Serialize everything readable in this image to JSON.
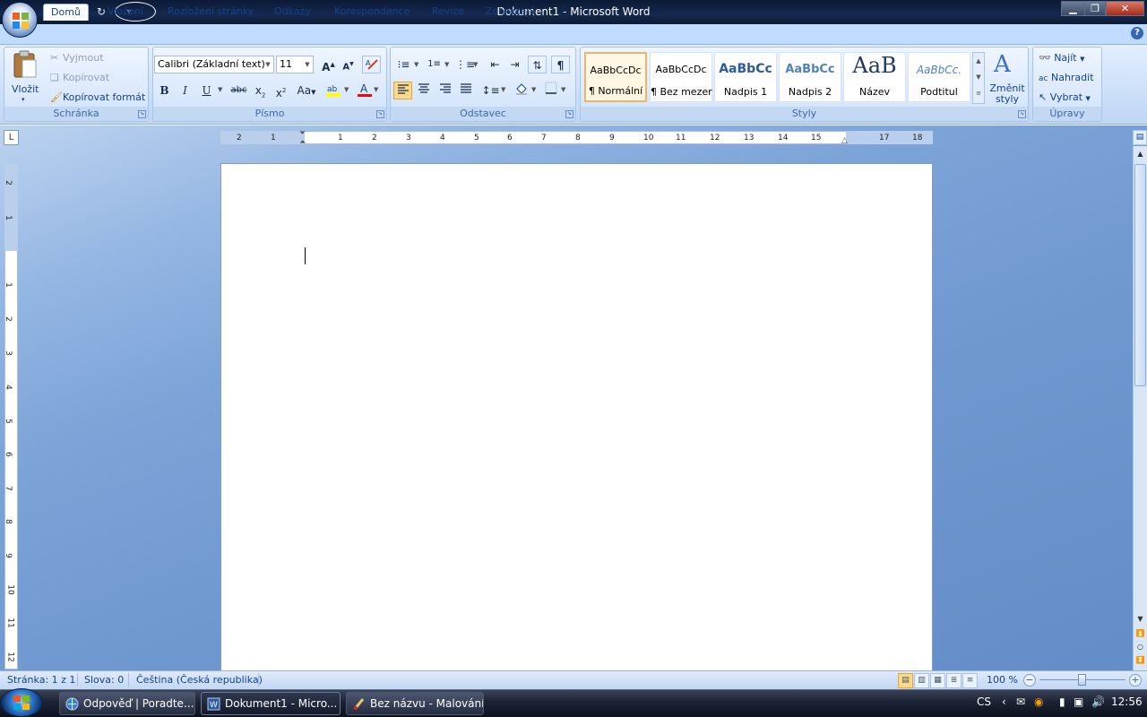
{
  "window": {
    "title": "Dokument1 - Microsoft Word"
  },
  "tabs": [
    "Domů",
    "Vložení",
    "Rozložení stránky",
    "Odkazy",
    "Korespondence",
    "Revize",
    "Zobrazení"
  ],
  "clipboard": {
    "paste": "Vložit",
    "cut": "Vyjmout",
    "copy": "Kopírovat",
    "format_painter": "Kopírovat formát",
    "label": "Schránka"
  },
  "font": {
    "family": "Calibri (Základní text)",
    "size": "11",
    "label": "Písmo",
    "case_btn": "Aa"
  },
  "paragraph": {
    "label": "Odstavec"
  },
  "styles": {
    "label": "Styly",
    "items": [
      {
        "preview": "AaBbCcDc",
        "name": "¶ Normální"
      },
      {
        "preview": "AaBbCcDc",
        "name": "¶ Bez mezer"
      },
      {
        "preview": "AaBbCc",
        "name": "Nadpis 1"
      },
      {
        "preview": "AaBbCc",
        "name": "Nadpis 2"
      },
      {
        "preview": "AaB",
        "name": "Název"
      },
      {
        "preview": "AaBbCc.",
        "name": "Podtitul"
      }
    ],
    "change": "Změnit styly"
  },
  "editing": {
    "find": "Najít",
    "replace": "Nahradit",
    "select": "Vybrat",
    "label": "Úpravy"
  },
  "ruler": {
    "h": [
      "2",
      "1",
      "1",
      "2",
      "3",
      "4",
      "5",
      "6",
      "7",
      "8",
      "9",
      "10",
      "11",
      "12",
      "13",
      "14",
      "15",
      "17",
      "18"
    ],
    "v": [
      "2",
      "1",
      "1",
      "2",
      "3",
      "4",
      "5",
      "6",
      "7",
      "8",
      "9",
      "10",
      "11",
      "12"
    ]
  },
  "status": {
    "page": "Stránka: 1 z 1",
    "words": "Slova: 0",
    "language": "Čeština (Česká republika)",
    "zoom": "100 %"
  },
  "taskbar": {
    "items": [
      "Odpověď | Poradte....",
      "Dokument1 - Micro...",
      "Bez názvu - Malování"
    ],
    "lang": "CS",
    "time": "12:56"
  },
  "colors": {
    "accent": "#15428b",
    "ribbon": "#c7dcf7",
    "highlight": "#ffff00",
    "font_color": "#ff0000"
  }
}
